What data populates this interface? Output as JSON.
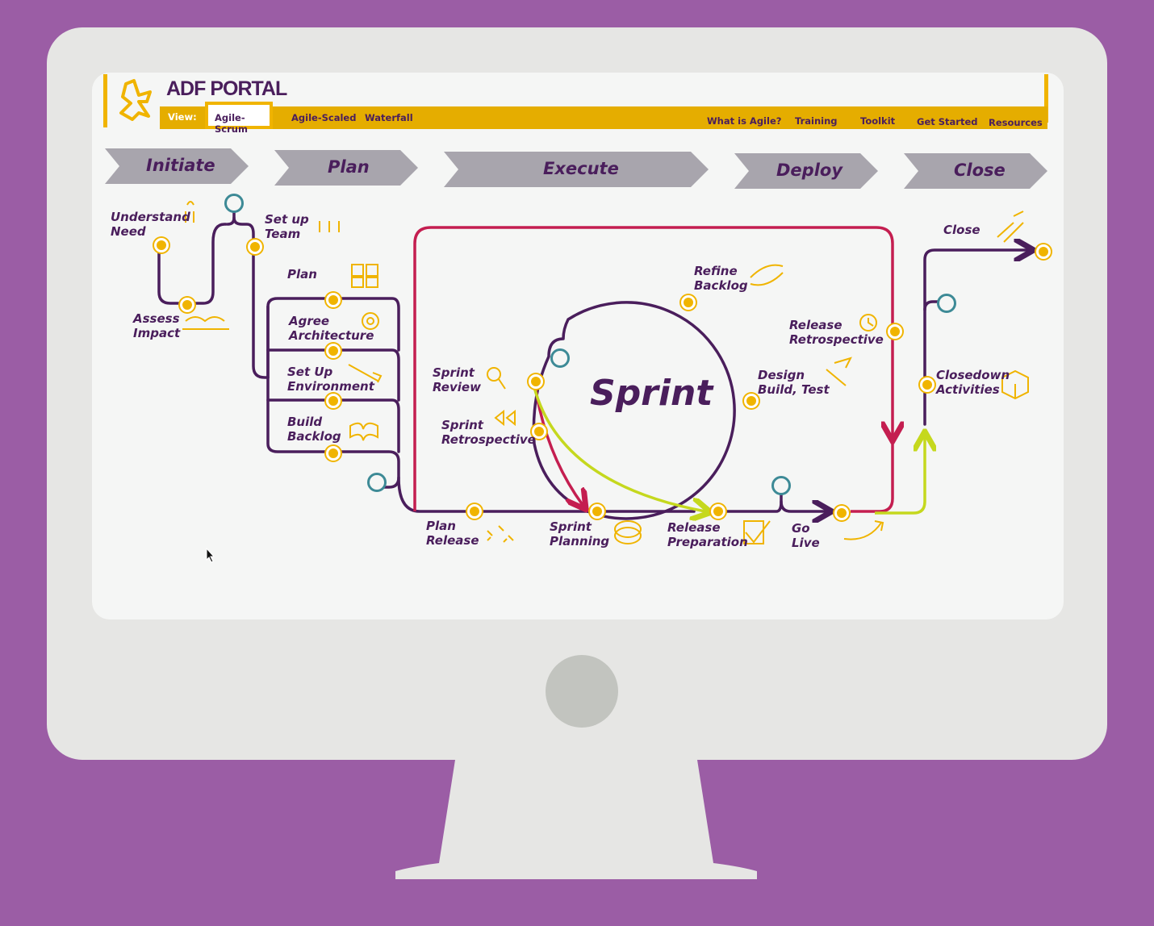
{
  "portal": {
    "title": "ADF PORTAL",
    "view_label": "View:"
  },
  "view_tabs": [
    "Agile-Scrum",
    "Agile-Scaled",
    "Waterfall"
  ],
  "nav_links": [
    "What is Agile?",
    "Training",
    "Toolkit",
    "Get Started",
    "Resources"
  ],
  "phases": [
    "Initiate",
    "Plan",
    "Execute",
    "Deploy",
    "Close"
  ],
  "steps": {
    "understand_need": "Understand\nNeed",
    "assess_impact": "Assess\nImpact",
    "set_up_team": "Set up\nTeam",
    "plan": "Plan",
    "agree_architecture": "Agree\nArchitecture",
    "set_up_environment": "Set Up\nEnvironment",
    "build_backlog": "Build\nBacklog",
    "plan_release": "Plan\nRelease",
    "sprint_review": "Sprint\nReview",
    "sprint_retrospective": "Sprint\nRetrospective",
    "refine_backlog": "Refine\nBacklog",
    "design_build_test": "Design\nBuild, Test",
    "sprint_planning": "Sprint\nPlanning",
    "release_preparation": "Release\nPreparation",
    "go_live": "Go\nLive",
    "release_retrospective": "Release\nRetrospective",
    "close": "Close",
    "closedown_activities": "Closedown\nActivities"
  },
  "sprint_title": "Sprint",
  "colors": {
    "purple": "#4a1e5c",
    "gold": "#f0b400",
    "crimson": "#c41e50",
    "lime": "#c5d81e",
    "teal": "#3d8a96",
    "background": "#9b5da5"
  }
}
